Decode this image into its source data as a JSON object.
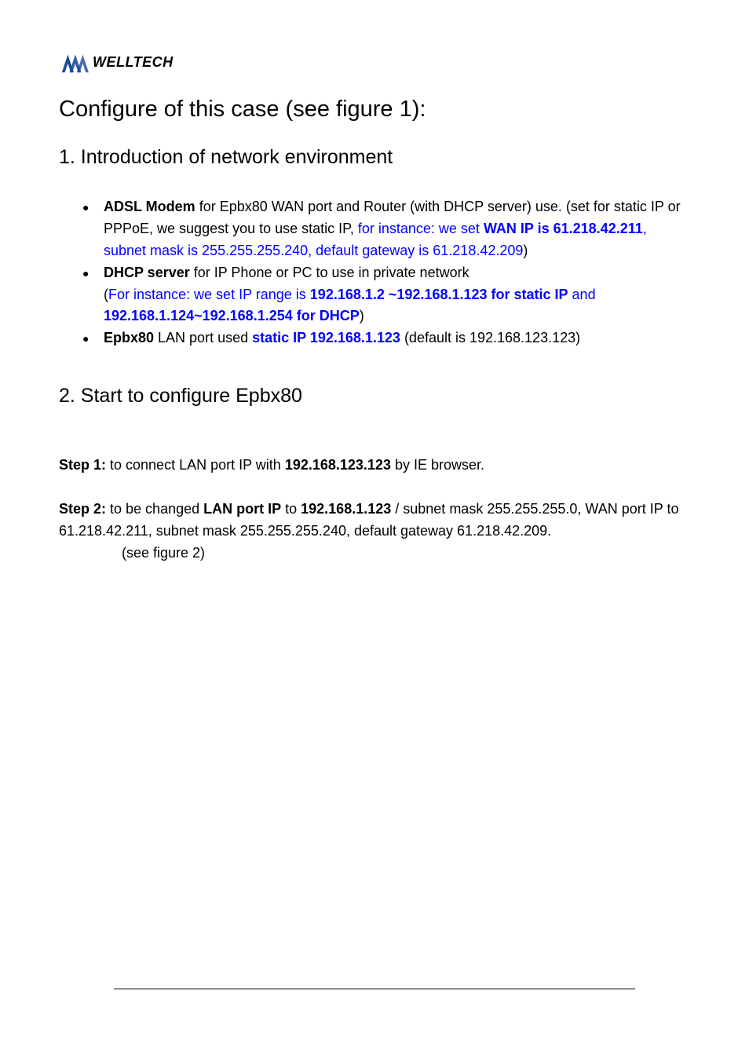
{
  "logo": {
    "brand": "WELLTECH"
  },
  "title": "Configure of this case (see figure 1):",
  "section1": {
    "heading": "1. Introduction of network environment",
    "bullets": {
      "b1": {
        "prefix_bold": "ADSL Modem",
        "t1": " for Epbx80 WAN port and Router (with DHCP server) use. (set for static IP or PPPoE, we suggest you to use static IP, ",
        "blue1": "for instance: we set ",
        "blue_bold": "WAN IP is 61.218.42.211",
        "blue2": ", subnet mask is 255.255.255.240, default gateway is 61.218.42.209",
        "t2": ")"
      },
      "b2": {
        "prefix_bold": "DHCP server",
        "t1": " for IP Phone or PC to use in private network",
        "line2_open": " (",
        "blue1": "For instance: we set IP range is ",
        "blue_bold1": "192.168.1.2 ~192.168.1.123 for static IP",
        "blue2": " and ",
        "blue_bold2": "192.168.1.124~192.168.1.254 for DHCP",
        "close": ")"
      },
      "b3": {
        "prefix_bold": "Epbx80",
        "t1": " LAN port used ",
        "blue_bold": "static IP 192.168.1.123",
        "t2": " (default is 192.168.123.123)"
      }
    }
  },
  "section2": {
    "heading": "2. Start to configure Epbx80",
    "step1": {
      "label": "Step 1:",
      "t1": " to connect LAN port IP with ",
      "bold1": "192.168.123.123",
      "t2": " by IE browser."
    },
    "step2": {
      "label": "Step 2:",
      "t1": " to be changed ",
      "bold1": "LAN port IP",
      "t2": " to ",
      "bold2": "192.168.1.123",
      "t3": " / subnet mask 255.255.255.0, WAN port IP to 61.218.42.211, subnet mask 255.255.255.240, default gateway 61.218.42.209.",
      "t4": "(see figure 2)"
    }
  }
}
